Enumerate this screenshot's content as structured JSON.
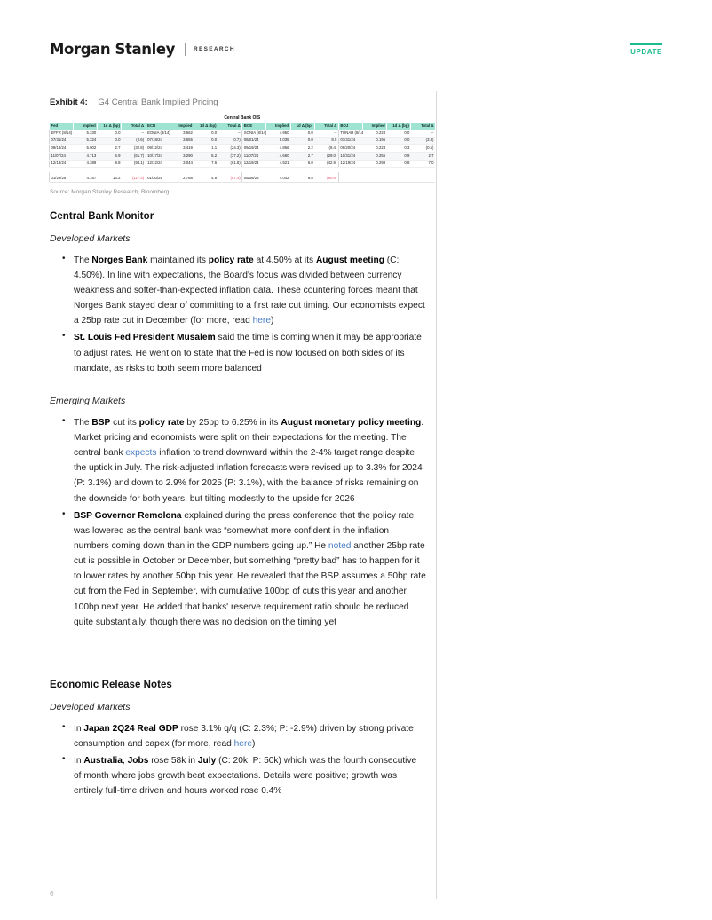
{
  "header": {
    "brand": "Morgan Stanley",
    "divider_label": "RESEARCH",
    "update_badge": "UPDATE"
  },
  "exhibit": {
    "label": "Exhibit 4:",
    "title": "G4 Central Bank Implied Pricing",
    "table_title": "Central Bank OIS",
    "source": "Source: Morgan Stanley Research, Bloomberg",
    "columns": [
      "Implied",
      "1d Δ (bp)",
      "Total Δ"
    ],
    "blocks": [
      {
        "name": "Fed",
        "rows": [
          {
            "date": "EFFR (8/14)",
            "implied": "5.330",
            "d1": "0.0",
            "total": "--",
            "total_neg": false
          },
          {
            "date": "07/31/24",
            "implied": "5.324",
            "d1": "0.0",
            "total": "(0.6)",
            "total_neg": true
          },
          {
            "date": "09/18/24",
            "implied": "5.002",
            "d1": "2.7",
            "total": "(32.8)",
            "total_neg": true
          },
          {
            "date": "11/07/24",
            "implied": "4.713",
            "d1": "6.9",
            "total": "(61.7)",
            "total_neg": true
          },
          {
            "date": "12/18/24",
            "implied": "4.389",
            "d1": "9.8",
            "total": "(94.1)",
            "total_neg": true
          }
        ],
        "total_row": {
          "date": "01/29/25",
          "implied": "4.157",
          "d1": "13.2",
          "total": "(117.3)",
          "total_neg": true
        }
      },
      {
        "name": "ECB",
        "rows": [
          {
            "date": "EONIA (8/14)",
            "implied": "3.662",
            "d1": "0.0",
            "total": "--",
            "total_neg": false
          },
          {
            "date": "07/18/24",
            "implied": "3.655",
            "d1": "0.0",
            "total": "(0.7)",
            "total_neg": true
          },
          {
            "date": "09/12/24",
            "implied": "3.419",
            "d1": "1.1",
            "total": "(24.3)",
            "total_neg": true
          },
          {
            "date": "10/17/24",
            "implied": "3.290",
            "d1": "5.2",
            "total": "(37.2)",
            "total_neg": true
          },
          {
            "date": "12/12/24",
            "implied": "3.044",
            "d1": "7.6",
            "total": "(61.8)",
            "total_neg": true
          }
        ],
        "total_row": {
          "date": "01/30/25",
          "implied": "2.788",
          "d1": "4.8",
          "total": "(87.4)",
          "total_neg": true
        }
      },
      {
        "name": "BOE",
        "rows": [
          {
            "date": "SONIA (8/14)",
            "implied": "4.950",
            "d1": "0.0",
            "total": "--",
            "total_neg": false
          },
          {
            "date": "08/01/24",
            "implied": "5.035",
            "d1": "0.0",
            "total": "8.5",
            "total_neg": false
          },
          {
            "date": "09/19/24",
            "implied": "4.866",
            "d1": "2.2",
            "total": "(8.4)",
            "total_neg": true
          },
          {
            "date": "11/07/24",
            "implied": "4.660",
            "d1": "2.7",
            "total": "(29.0)",
            "total_neg": true
          },
          {
            "date": "12/19/24",
            "implied": "4.521",
            "d1": "6.0",
            "total": "(42.9)",
            "total_neg": true
          }
        ],
        "total_row": {
          "date": "05/08/25",
          "implied": "4.042",
          "d1": "9.8",
          "total": "(90.6)",
          "total_neg": true
        }
      },
      {
        "name": "BOJ",
        "rows": [
          {
            "date": "TONAR (8/14)",
            "implied": "0.228",
            "d1": "0.0",
            "total": "--",
            "total_neg": false
          },
          {
            "date": "07/31/24",
            "implied": "0.195",
            "d1": "0.0",
            "total": "(3.3)",
            "total_neg": true
          },
          {
            "date": "09/20/24",
            "implied": "0.223",
            "d1": "0.3",
            "total": "(0.5)",
            "total_neg": true
          },
          {
            "date": "10/31/24",
            "implied": "0.255",
            "d1": "0.9",
            "total": "2.7",
            "total_neg": false
          },
          {
            "date": "12/19/24",
            "implied": "0.298",
            "d1": "0.8",
            "total": "7.0",
            "total_neg": false
          }
        ],
        "total_row": {
          "date": "",
          "implied": "",
          "d1": "",
          "total": "",
          "total_neg": false
        }
      }
    ]
  },
  "central_bank_monitor": {
    "title": "Central Bank Monitor",
    "developed_markets_label": "Developed Markets",
    "developed_bullets": [
      {
        "segments": [
          {
            "t": "The ",
            "s": "plain"
          },
          {
            "t": "Norges Bank",
            "s": "bold"
          },
          {
            "t": " maintained its ",
            "s": "plain"
          },
          {
            "t": "policy rate",
            "s": "bold"
          },
          {
            "t": " at 4.50% at its ",
            "s": "plain"
          },
          {
            "t": "August meeting",
            "s": "bold"
          },
          {
            "t": " (C: 4.50%). In line with expectations, the Board's focus was divided between currency weakness and softer-than-expected inflation data. These countering forces meant that Norges Bank stayed clear of committing to a first rate cut timing. Our economists expect a 25bp rate cut in December (for more, read ",
            "s": "plain"
          },
          {
            "t": "here",
            "s": "link"
          },
          {
            "t": ")",
            "s": "plain"
          }
        ]
      },
      {
        "segments": [
          {
            "t": "St. Louis Fed President Musalem",
            "s": "bold"
          },
          {
            "t": " said the time is coming when it may be appropriate to adjust rates. He went on to state that the Fed is now focused on both sides of its mandate, as risks to both seem more balanced",
            "s": "plain"
          }
        ]
      }
    ],
    "emerging_markets_label": "Emerging Markets",
    "emerging_bullets": [
      {
        "segments": [
          {
            "t": "The ",
            "s": "plain"
          },
          {
            "t": "BSP",
            "s": "bold"
          },
          {
            "t": " cut its ",
            "s": "plain"
          },
          {
            "t": "policy rate",
            "s": "bold"
          },
          {
            "t": " by 25bp to 6.25% in its ",
            "s": "plain"
          },
          {
            "t": "August monetary policy meeting",
            "s": "bold"
          },
          {
            "t": ". Market pricing and economists were split on their expectations for the meeting. The central bank ",
            "s": "plain"
          },
          {
            "t": "expects",
            "s": "link"
          },
          {
            "t": " inflation to trend downward within the 2-4% target range despite the uptick in July. The risk-adjusted inflation forecasts were revised up to 3.3% for 2024 (P: 3.1%) and down to 2.9% for 2025 (P: 3.1%), with the balance of risks remaining on the downside for both years, but tilting modestly to the upside for 2026",
            "s": "plain"
          }
        ]
      },
      {
        "segments": [
          {
            "t": "BSP Governor Remolona",
            "s": "bold"
          },
          {
            "t": " explained during the press conference that the policy rate was lowered as the central bank was “somewhat more confident in the inflation numbers coming down than in the GDP numbers going up.” He ",
            "s": "plain"
          },
          {
            "t": "noted",
            "s": "link"
          },
          {
            "t": " another 25bp rate cut is possible in October or December, but something “pretty bad” has to happen for it to lower rates by another 50bp this year. He revealed that the BSP assumes a 50bp rate cut from the Fed in September, with cumulative 100bp of cuts this year and another 100bp next year. He added that banks' reserve requirement ratio should be reduced quite substantially, though there was no decision on the timing yet",
            "s": "plain"
          }
        ]
      }
    ]
  },
  "economic_release_notes": {
    "title": "Economic Release Notes",
    "developed_markets_label": "Developed Markets",
    "developed_bullets": [
      {
        "segments": [
          {
            "t": "In ",
            "s": "plain"
          },
          {
            "t": "Japan 2Q24 Real GDP",
            "s": "bold"
          },
          {
            "t": " rose 3.1% q/q (C: 2.3%; P: -2.9%) driven by strong private consumption and capex (for more, read ",
            "s": "plain"
          },
          {
            "t": "here",
            "s": "link"
          },
          {
            "t": ")",
            "s": "plain"
          }
        ]
      },
      {
        "segments": [
          {
            "t": "In ",
            "s": "plain"
          },
          {
            "t": "Australia",
            "s": "bold"
          },
          {
            "t": ", ",
            "s": "plain"
          },
          {
            "t": "Jobs",
            "s": "bold"
          },
          {
            "t": " rose 58k in ",
            "s": "plain"
          },
          {
            "t": "July",
            "s": "bold"
          },
          {
            "t": " (C: 20k; P: 50k) which was the fourth consecutive of month where jobs growth beat expectations. Details were positive; growth was entirely full-time driven and hours worked rose 0.4%",
            "s": "plain"
          }
        ]
      }
    ]
  },
  "footer": {
    "page_number": "6"
  }
}
